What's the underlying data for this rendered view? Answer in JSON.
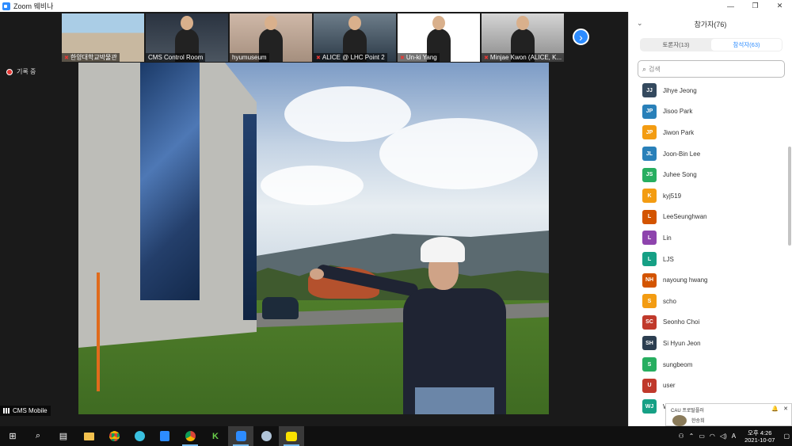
{
  "window": {
    "title": "Zoom 웨비나",
    "min_glyph": "—",
    "max_glyph": "❐",
    "close_glyph": "✕"
  },
  "gallery": {
    "tiles": [
      {
        "name": "한양대학교박물관",
        "muted": true
      },
      {
        "name": "CMS Control Room",
        "muted": false
      },
      {
        "name": "hyumuseum",
        "muted": false
      },
      {
        "name": "ALICE @ LHC Point 2",
        "muted": true
      },
      {
        "name": "Un-ki Yang",
        "muted": true
      },
      {
        "name": "Minjae Kwon (ALICE, K...",
        "muted": true
      }
    ],
    "next_glyph": "›"
  },
  "recording": {
    "label": "기록 중"
  },
  "main_video": {
    "name": "CMS Mobile"
  },
  "panel": {
    "title": "참가자(76)",
    "collapse_glyph": "⌄",
    "tabs": [
      {
        "label": "토론자(13)",
        "active": false
      },
      {
        "label": "참석자(63)",
        "active": true
      }
    ],
    "search_placeholder": "검색",
    "participants": [
      {
        "initials": "JJ",
        "name": "Jihye Jeong",
        "color": "#34495e"
      },
      {
        "initials": "JP",
        "name": "Jisoo Park",
        "color": "#2980b9"
      },
      {
        "initials": "JP",
        "name": "Jiwon Park",
        "color": "#f39c12"
      },
      {
        "initials": "JL",
        "name": "Joon-Bin Lee",
        "color": "#2980b9"
      },
      {
        "initials": "JS",
        "name": "Juhee Song",
        "color": "#27ae60"
      },
      {
        "initials": "K",
        "name": "kyj519",
        "color": "#f39c12"
      },
      {
        "initials": "L",
        "name": "LeeSeunghwan",
        "color": "#d35400"
      },
      {
        "initials": "L",
        "name": "Lin",
        "color": "#8e44ad"
      },
      {
        "initials": "L",
        "name": "LJS",
        "color": "#16a085"
      },
      {
        "initials": "NH",
        "name": "nayoung hwang",
        "color": "#d35400"
      },
      {
        "initials": "S",
        "name": "scho",
        "color": "#f39c12"
      },
      {
        "initials": "SC",
        "name": "Seonho Choi",
        "color": "#c0392b"
      },
      {
        "initials": "SH",
        "name": "Si Hyun Jeon",
        "color": "#2c3e50"
      },
      {
        "initials": "S",
        "name": "sungbeom",
        "color": "#27ae60"
      },
      {
        "initials": "U",
        "name": "user",
        "color": "#c0392b"
      },
      {
        "initials": "WJ",
        "name": "W",
        "color": "#16a085"
      }
    ]
  },
  "notification": {
    "app": "CAU 프로탈플러",
    "sender": "한승희"
  },
  "taskbar": {
    "icons": [
      "windows-icon",
      "search-icon",
      "task-view-icon",
      "file-explorer-icon",
      "chrome-icon",
      "app-bird-icon",
      "app-blue-icon",
      "chrome-alt-icon",
      "app-green-icon",
      "zoom-icon",
      "app-ball-icon",
      "kakaotalk-icon"
    ],
    "time": "오후 4:26",
    "date": "2021-10-07",
    "ime": "A"
  }
}
